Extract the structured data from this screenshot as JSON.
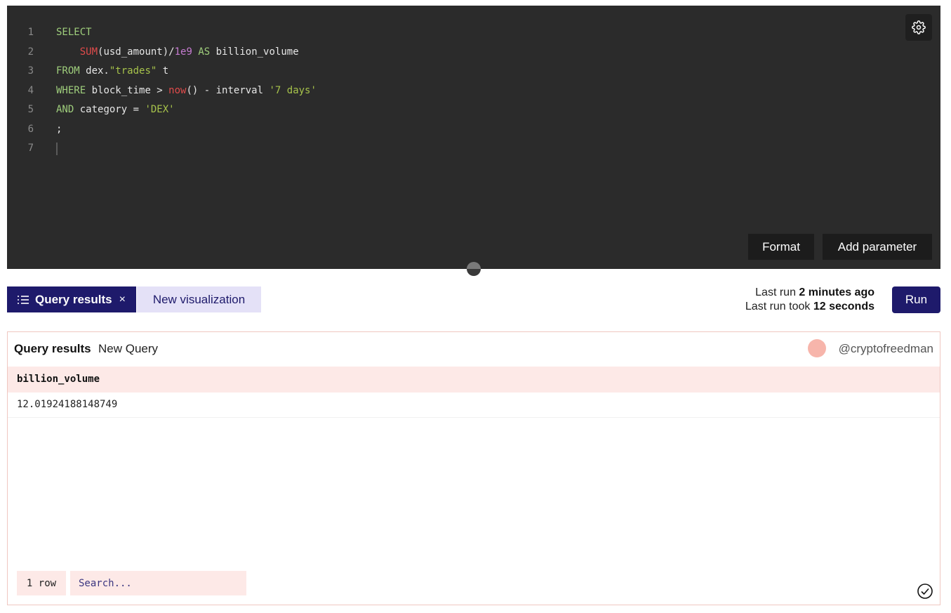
{
  "editor": {
    "lines": [
      {
        "n": "1",
        "tokens": [
          {
            "t": "SELECT",
            "c": "kw"
          }
        ]
      },
      {
        "n": "2",
        "tokens": [
          {
            "t": "    ",
            "c": ""
          },
          {
            "t": "SUM",
            "c": "fn"
          },
          {
            "t": "(usd_amount)/",
            "c": ""
          },
          {
            "t": "1e9",
            "c": "num"
          },
          {
            "t": " ",
            "c": ""
          },
          {
            "t": "AS",
            "c": "kw"
          },
          {
            "t": " billion_volume",
            "c": ""
          }
        ]
      },
      {
        "n": "3",
        "tokens": [
          {
            "t": "FROM",
            "c": "kw"
          },
          {
            "t": " dex.",
            "c": ""
          },
          {
            "t": "\"trades\"",
            "c": "str"
          },
          {
            "t": " t",
            "c": ""
          }
        ]
      },
      {
        "n": "4",
        "tokens": [
          {
            "t": "WHERE",
            "c": "kw"
          },
          {
            "t": " block_time > ",
            "c": ""
          },
          {
            "t": "now",
            "c": "fn"
          },
          {
            "t": "() - interval ",
            "c": ""
          },
          {
            "t": "'7 days'",
            "c": "str"
          }
        ]
      },
      {
        "n": "5",
        "tokens": [
          {
            "t": "AND",
            "c": "kw"
          },
          {
            "t": " category = ",
            "c": ""
          },
          {
            "t": "'DEX'",
            "c": "str"
          }
        ]
      },
      {
        "n": "6",
        "tokens": [
          {
            "t": ";",
            "c": ""
          }
        ]
      },
      {
        "n": "7",
        "tokens": []
      }
    ],
    "format_label": "Format",
    "add_parameter_label": "Add parameter"
  },
  "tabs": {
    "results_label": "Query results",
    "close_glyph": "×",
    "new_viz_label": "New visualization"
  },
  "run": {
    "last_run_prefix": "Last run",
    "last_run_value": "2 minutes ago",
    "took_prefix": "Last run took",
    "took_value": "12 seconds",
    "run_label": "Run"
  },
  "results": {
    "title": "Query results",
    "query_name": "New Query",
    "username": "@cryptofreedman",
    "columns": [
      "billion_volume"
    ],
    "rows": [
      [
        "12.01924188148749"
      ]
    ],
    "row_count": "1 row",
    "search_placeholder": "Search..."
  },
  "colors": {
    "accent": "#1e1a6b",
    "editor_bg": "#2b2b2b",
    "results_tint": "#fde9e7"
  }
}
